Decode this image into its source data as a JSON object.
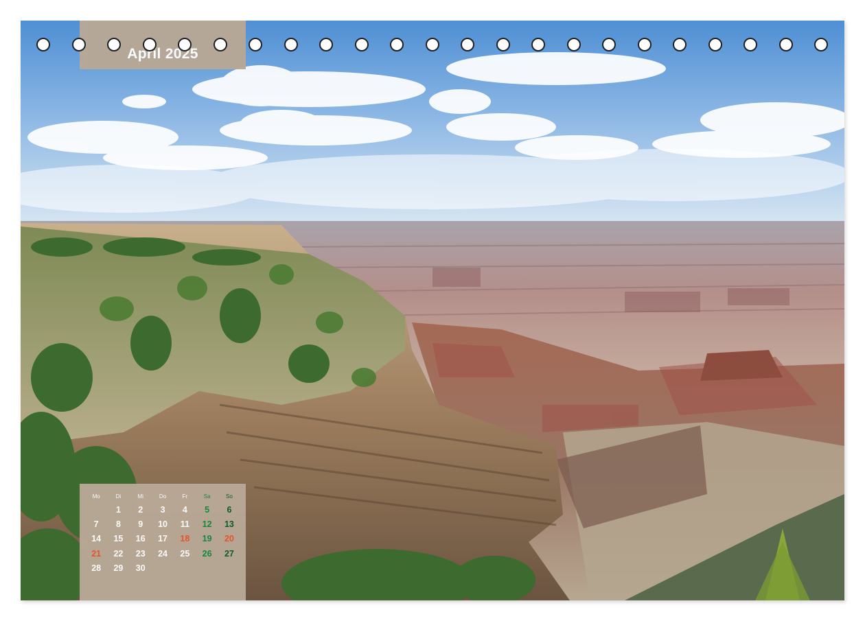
{
  "calendar": {
    "month_title": "April 2025",
    "weekdays": [
      "Mo",
      "Di",
      "Mi",
      "Do",
      "Fr",
      "Sa",
      "So"
    ],
    "first_weekday_index": 1,
    "days_in_month": 30,
    "holidays": [
      18,
      20,
      21
    ],
    "colors": {
      "panel": "#b8a896",
      "text": "#ffffff",
      "saturday": "#0f8a3c",
      "sunday": "#0b5a24",
      "holiday": "#e8542a"
    }
  },
  "binding": {
    "hole_count": 23
  },
  "photo": {
    "subject": "canyon-landscape"
  }
}
